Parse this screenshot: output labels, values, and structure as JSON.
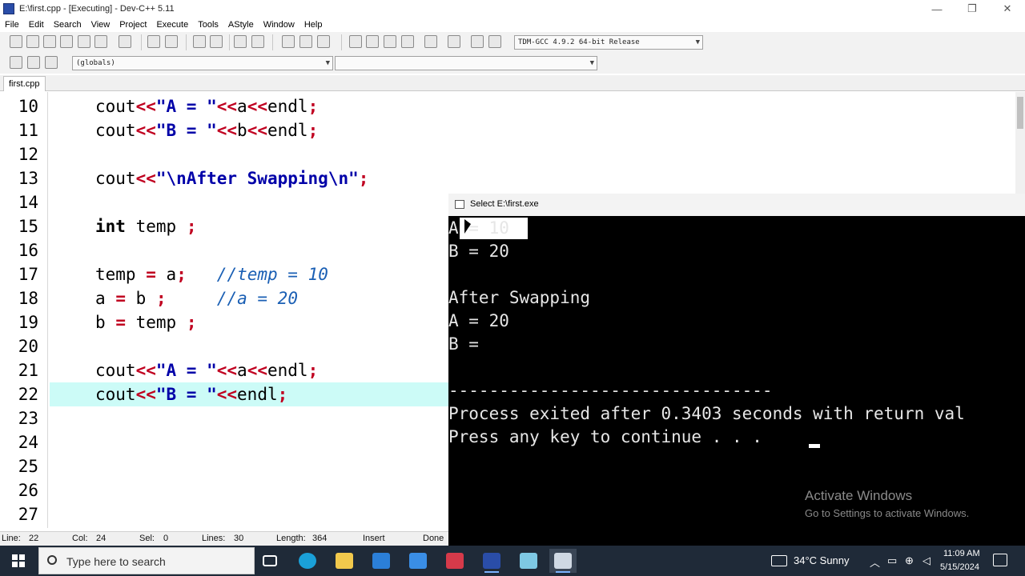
{
  "window": {
    "title": "E:\\first.cpp - [Executing] - Dev-C++ 5.11",
    "minimize": "—",
    "restore": "❐",
    "close": "✕"
  },
  "menu": [
    "File",
    "Edit",
    "Search",
    "View",
    "Project",
    "Execute",
    "Tools",
    "AStyle",
    "Window",
    "Help"
  ],
  "toolbar": {
    "compiler": "TDM-GCC 4.9.2 64-bit Release",
    "scope": "(globals)"
  },
  "tabs": {
    "file": "first.cpp"
  },
  "editor": {
    "current_line": "22",
    "lines": [
      {
        "n": "10"
      },
      {
        "n": "11"
      },
      {
        "n": "12"
      },
      {
        "n": "13"
      },
      {
        "n": "14"
      },
      {
        "n": "15"
      },
      {
        "n": "16"
      },
      {
        "n": "17"
      },
      {
        "n": "18"
      },
      {
        "n": "19"
      },
      {
        "n": "20"
      },
      {
        "n": "21"
      },
      {
        "n": "22"
      },
      {
        "n": "23"
      },
      {
        "n": "24"
      },
      {
        "n": "25"
      },
      {
        "n": "26"
      },
      {
        "n": "27"
      }
    ],
    "tokens": {
      "cout": "cout",
      "op_shift": "<<",
      "str_a": "\"A = \"",
      "str_b": "\"B = \"",
      "var_a": "a",
      "var_b": "b",
      "endl": "endl",
      "semi": ";",
      "str_after": "\"\\nAfter Swapping\\n\"",
      "kw_int": "int",
      "temp": "temp",
      "eq": "=",
      "cmt_temp": "//temp = 10",
      "cmt_a": "//a = 20"
    }
  },
  "status": {
    "line": "Line:",
    "line_val": "22",
    "col": "Col:",
    "col_val": "24",
    "sel": "Sel:",
    "sel_val": "0",
    "lines": "Lines:",
    "lines_val": "30",
    "length": "Length:",
    "length_val": "364",
    "mode": "Insert",
    "done": "Done"
  },
  "console": {
    "title": "Select E:\\first.exe",
    "lines": [
      "A = 10",
      "B = 20",
      "",
      "After Swapping",
      "A = 20",
      "B = ",
      "",
      "--------------------------------",
      "Process exited after 0.3403 seconds with return val",
      "Press any key to continue . . . "
    ],
    "watermark_title": "Activate Windows",
    "watermark_sub": "Go to Settings to activate Windows."
  },
  "taskbar": {
    "search_placeholder": "Type here to search",
    "weather": "34°C  Sunny",
    "time": "11:09 AM",
    "date": "5/15/2024"
  },
  "colors": {
    "current_line_bg": "#ccfbf7",
    "operator": "#c00020",
    "string": "#0000a8",
    "comment": "#1a5fb4",
    "taskbar": "#1f2a38"
  }
}
